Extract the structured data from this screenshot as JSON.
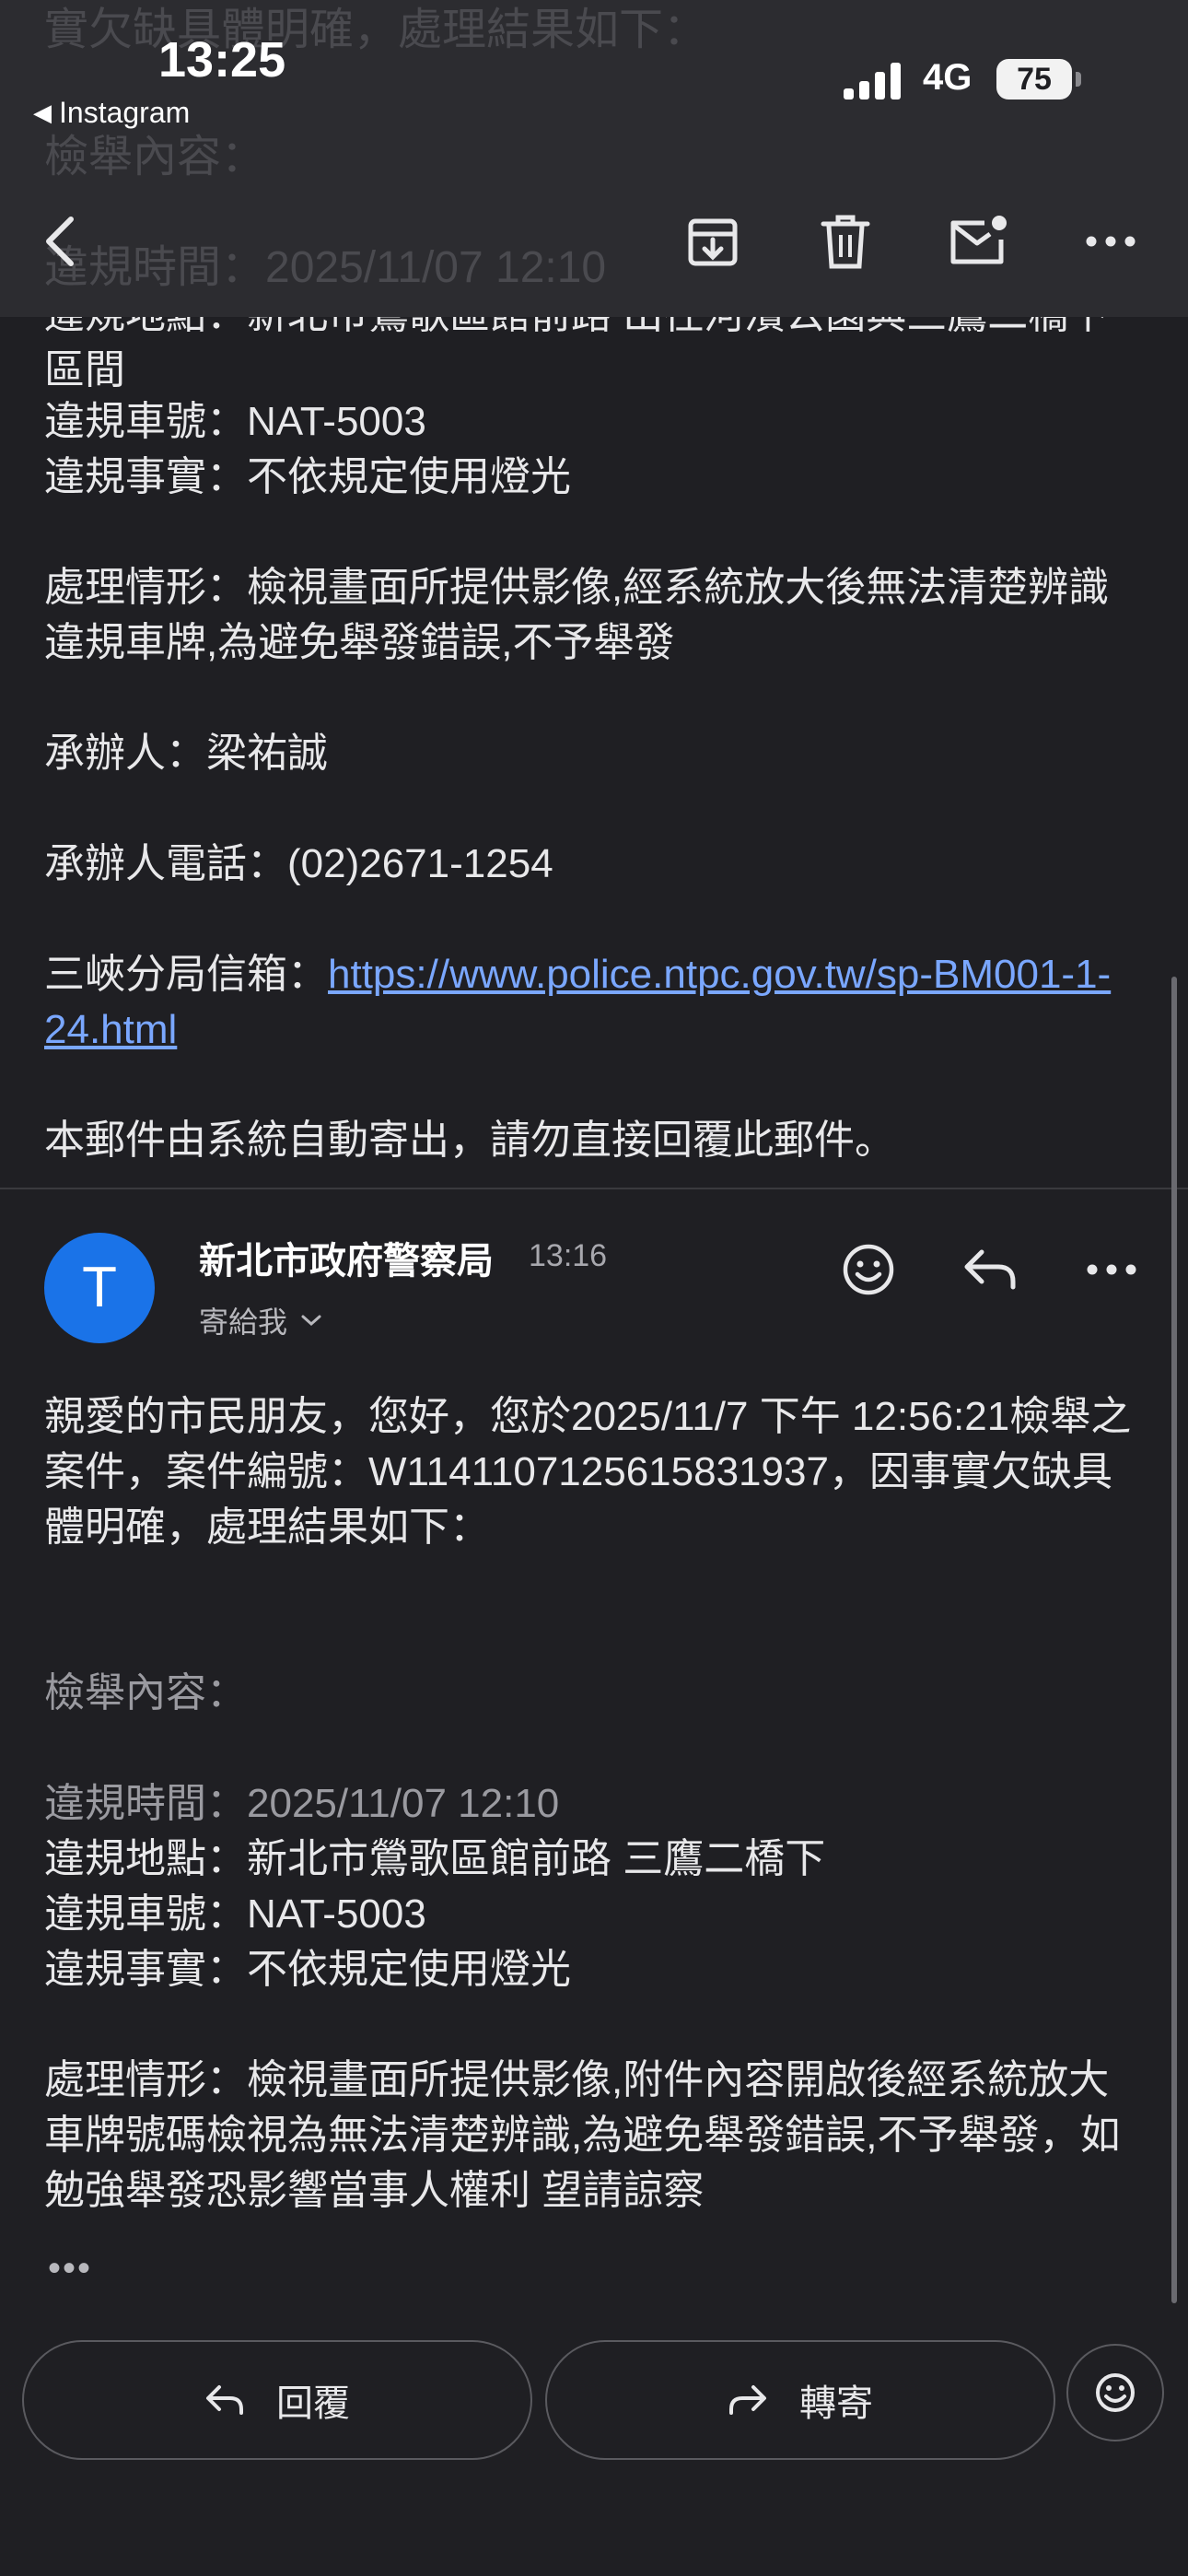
{
  "status_bar": {
    "time": "13:25",
    "back_app": "Instagram",
    "network": "4G",
    "battery": "75"
  },
  "icons": [
    "back-icon",
    "archive-icon",
    "trash-icon",
    "mark-unread-icon",
    "more-icon",
    "emoji-icon",
    "reply-icon",
    "forward-icon",
    "chevron-down-icon",
    "signal-icon"
  ],
  "ghost_text": {
    "line1": "實欠缺具體明確，處理結果如下：",
    "line2": "檢舉內容：",
    "line3": "違規時間：2025/11/07 12:10"
  },
  "prev_message": {
    "location_partial": "違規地點：新北市鶯歌區館前路 出往河濱公園與三鷹二橋下區間",
    "plate": "違規車號：NAT-5003",
    "fact": "違規事實：不依規定使用燈光",
    "handling": "處理情形：檢視畫面所提供影像,經系統放大後無法清楚辨識違規車牌,為避免舉發錯誤,不予舉發",
    "officer": "承辦人：梁祐誠",
    "officer_phone": "承辦人電話：(02)2671-1254",
    "mailbox_label": "三峽分局信箱：",
    "mailbox_url": "https://www.police.ntpc.gov.tw/sp-BM001-1-24.html",
    "auto_notice": "本郵件由系統自動寄出，請勿直接回覆此郵件。"
  },
  "message": {
    "avatar_letter": "T",
    "sender": "新北市政府警察局",
    "time": "13:16",
    "to": "寄給我",
    "greeting": "親愛的市民朋友，您好，您於2025/11/7 下午 12:56:21檢舉之案件，案件編號：W1141107125615831937，因事實欠缺具體明確，處理結果如下：",
    "content_label": "檢舉內容：",
    "violation_time": "違規時間：2025/11/07 12:10",
    "violation_location": "違規地點：新北市鶯歌區館前路 三鷹二橋下",
    "violation_plate": "違規車號：NAT-5003",
    "violation_fact": "違規事實：不依規定使用燈光",
    "handling": "處理情形：檢視畫面所提供影像,附件內容開啟後經系統放大車牌號碼檢視為無法清楚辨識,為避免舉發錯誤,不予舉發，如勉強舉發恐影響當事人權利 望請諒察",
    "ellipsis": "•••"
  },
  "actions": {
    "reply": "回覆",
    "forward": "轉寄"
  },
  "colors": {
    "background": "#1f1f23",
    "topbar": "#2c2c30",
    "avatar": "#1a73e8",
    "link": "#7aa7ff"
  }
}
